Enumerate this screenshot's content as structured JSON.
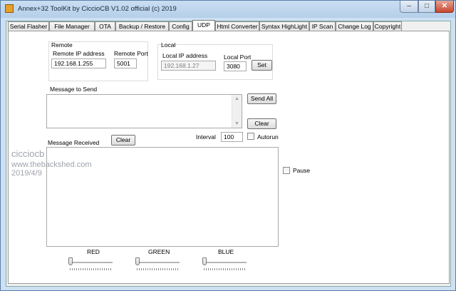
{
  "window": {
    "title": "Annex+32 ToolKit by CiccioCB V1.02 official (c) 2019"
  },
  "tabs": [
    "Serial Flasher",
    "File Manager",
    "OTA",
    "Backup / Restore",
    "Config",
    "UDP",
    "Html Converter",
    "Syntax HighLight",
    "IP Scan",
    "Change Log",
    "Copyright"
  ],
  "active_tab": "UDP",
  "remote": {
    "group_label": "Remote",
    "ip_label": "Remote IP address",
    "ip_value": "192.168.1.255",
    "port_label": "Remote Port",
    "port_value": "5001"
  },
  "local": {
    "group_label": "Local",
    "ip_label": "Local IP address",
    "ip_value": "192.168.1.27",
    "port_label": "Local Port",
    "port_value": "3080",
    "set_label": "Set"
  },
  "send": {
    "label": "Message to Send",
    "send_all_label": "Send All",
    "clear_label": "Clear"
  },
  "receive": {
    "label": "Message Received",
    "clear_label": "Clear",
    "interval_label": "Interval",
    "interval_value": "100",
    "autorun_label": "Autorun",
    "pause_label": "Pause"
  },
  "watermark": {
    "line1": "cicciocb",
    "line2": "www.thebackshed.com",
    "line3": "2019/4/9"
  },
  "sliders": {
    "red_label": "RED",
    "green_label": "GREEN",
    "blue_label": "BLUE",
    "red_value": 0,
    "green_value": 0,
    "blue_value": 0
  },
  "icons": {
    "app": "app-icon",
    "minimize": "minimize-icon",
    "maximize": "maximize-icon",
    "close": "close-icon"
  }
}
